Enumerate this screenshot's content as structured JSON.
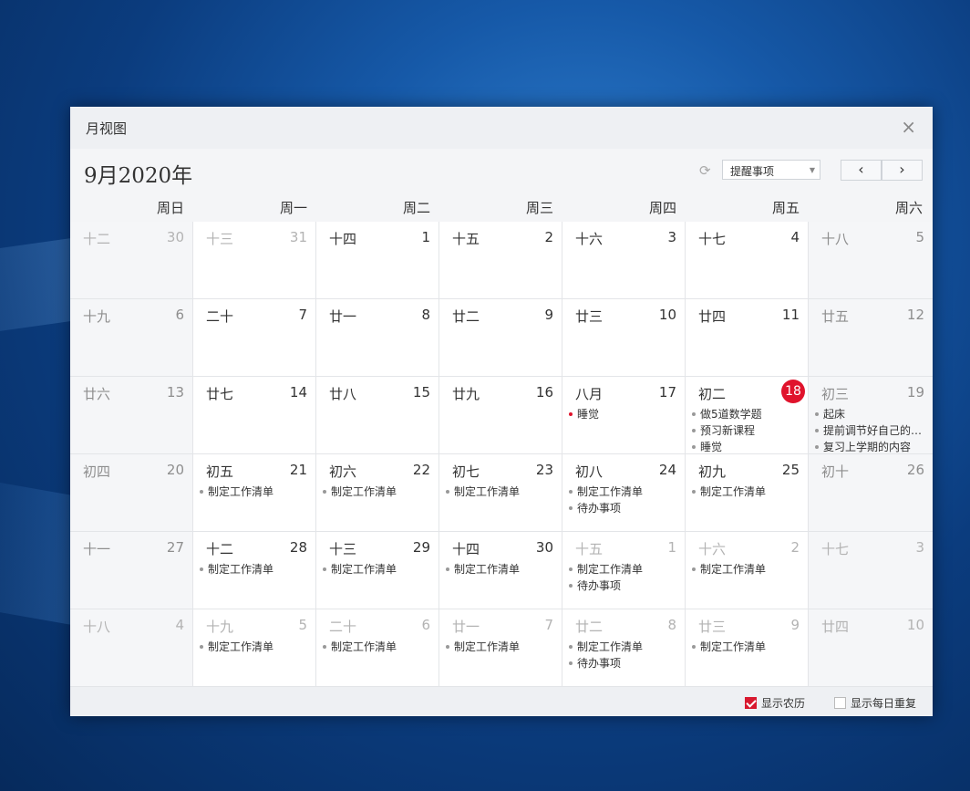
{
  "window": {
    "title": "月视图",
    "close_icon": "×"
  },
  "header": {
    "month_title": "9月2020年",
    "refresh_icon": "⟳",
    "filter_select": "提醒事项",
    "prev_icon": "‹",
    "next_icon": "›"
  },
  "weekdays": [
    "周日",
    "周一",
    "周二",
    "周三",
    "周四",
    "周五",
    "周六"
  ],
  "colors": {
    "accent": "#e0132c",
    "dot_gray": "#999999"
  },
  "weeks": [
    [
      {
        "lunar": "十二",
        "day": "30",
        "other": true,
        "events": []
      },
      {
        "lunar": "十三",
        "day": "31",
        "other": true,
        "events": []
      },
      {
        "lunar": "十四",
        "day": "1",
        "events": []
      },
      {
        "lunar": "十五",
        "day": "2",
        "events": []
      },
      {
        "lunar": "十六",
        "day": "3",
        "events": []
      },
      {
        "lunar": "十七",
        "day": "4",
        "events": []
      },
      {
        "lunar": "十八",
        "day": "5",
        "events": []
      }
    ],
    [
      {
        "lunar": "十九",
        "day": "6",
        "events": []
      },
      {
        "lunar": "二十",
        "day": "7",
        "events": []
      },
      {
        "lunar": "廿一",
        "day": "8",
        "events": []
      },
      {
        "lunar": "廿二",
        "day": "9",
        "events": []
      },
      {
        "lunar": "廿三",
        "day": "10",
        "events": []
      },
      {
        "lunar": "廿四",
        "day": "11",
        "events": []
      },
      {
        "lunar": "廿五",
        "day": "12",
        "events": []
      }
    ],
    [
      {
        "lunar": "廿六",
        "day": "13",
        "events": []
      },
      {
        "lunar": "廿七",
        "day": "14",
        "events": []
      },
      {
        "lunar": "廿八",
        "day": "15",
        "events": []
      },
      {
        "lunar": "廿九",
        "day": "16",
        "events": []
      },
      {
        "lunar": "八月",
        "day": "17",
        "events": [
          {
            "text": "睡觉",
            "red": true
          }
        ]
      },
      {
        "lunar": "初二",
        "day": "18",
        "today": true,
        "events": [
          {
            "text": "做5道数学题"
          },
          {
            "text": "预习新课程"
          },
          {
            "text": "睡觉"
          }
        ]
      },
      {
        "lunar": "初三",
        "day": "19",
        "events": [
          {
            "text": "起床"
          },
          {
            "text": "提前调节好自己的…"
          },
          {
            "text": "复习上学期的内容"
          }
        ]
      }
    ],
    [
      {
        "lunar": "初四",
        "day": "20",
        "events": []
      },
      {
        "lunar": "初五",
        "day": "21",
        "events": [
          {
            "text": "制定工作清单"
          }
        ]
      },
      {
        "lunar": "初六",
        "day": "22",
        "events": [
          {
            "text": "制定工作清单"
          }
        ]
      },
      {
        "lunar": "初七",
        "day": "23",
        "events": [
          {
            "text": "制定工作清单"
          }
        ]
      },
      {
        "lunar": "初八",
        "day": "24",
        "events": [
          {
            "text": "制定工作清单"
          },
          {
            "text": "待办事项"
          }
        ]
      },
      {
        "lunar": "初九",
        "day": "25",
        "events": [
          {
            "text": "制定工作清单"
          }
        ]
      },
      {
        "lunar": "初十",
        "day": "26",
        "events": []
      }
    ],
    [
      {
        "lunar": "十一",
        "day": "27",
        "events": []
      },
      {
        "lunar": "十二",
        "day": "28",
        "events": [
          {
            "text": "制定工作清单"
          }
        ]
      },
      {
        "lunar": "十三",
        "day": "29",
        "events": [
          {
            "text": "制定工作清单"
          }
        ]
      },
      {
        "lunar": "十四",
        "day": "30",
        "events": [
          {
            "text": "制定工作清单"
          }
        ]
      },
      {
        "lunar": "十五",
        "day": "1",
        "other": true,
        "events": [
          {
            "text": "制定工作清单"
          },
          {
            "text": "待办事项"
          }
        ]
      },
      {
        "lunar": "十六",
        "day": "2",
        "other": true,
        "events": [
          {
            "text": "制定工作清单"
          }
        ]
      },
      {
        "lunar": "十七",
        "day": "3",
        "other": true,
        "events": []
      }
    ],
    [
      {
        "lunar": "十八",
        "day": "4",
        "other": true,
        "events": []
      },
      {
        "lunar": "十九",
        "day": "5",
        "other": true,
        "events": [
          {
            "text": "制定工作清单"
          }
        ]
      },
      {
        "lunar": "二十",
        "day": "6",
        "other": true,
        "events": [
          {
            "text": "制定工作清单"
          }
        ]
      },
      {
        "lunar": "廿一",
        "day": "7",
        "other": true,
        "events": [
          {
            "text": "制定工作清单"
          }
        ]
      },
      {
        "lunar": "廿二",
        "day": "8",
        "other": true,
        "events": [
          {
            "text": "制定工作清单"
          },
          {
            "text": "待办事项"
          }
        ]
      },
      {
        "lunar": "廿三",
        "day": "9",
        "other": true,
        "events": [
          {
            "text": "制定工作清单"
          }
        ]
      },
      {
        "lunar": "廿四",
        "day": "10",
        "other": true,
        "events": []
      }
    ]
  ],
  "footer": {
    "show_lunar_label": "显示农历",
    "show_lunar_checked": true,
    "show_daily_repeat_label": "显示每日重复",
    "show_daily_repeat_checked": false
  }
}
